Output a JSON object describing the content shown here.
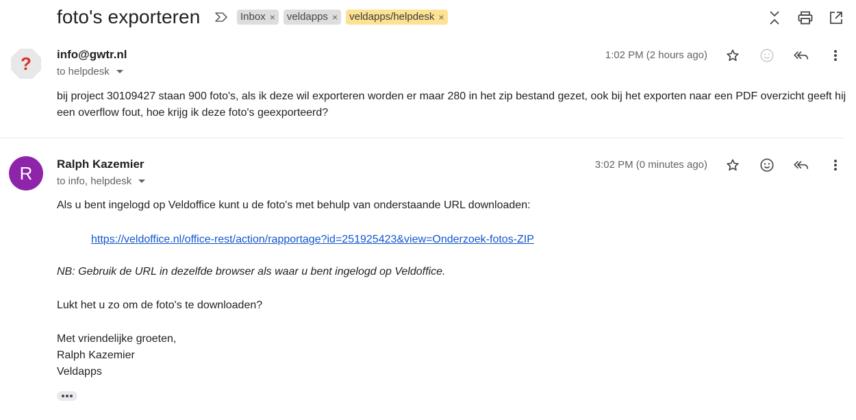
{
  "thread": {
    "subject": "foto's exporteren",
    "labels": [
      {
        "text": "Inbox",
        "color": "#dddddd"
      },
      {
        "text": "veldapps",
        "color": "#dddddd"
      },
      {
        "text": "veldapps/helpdesk",
        "color": "#fde293"
      }
    ],
    "remove_glyph": "×"
  },
  "messages": [
    {
      "avatar_letter": "?",
      "sender": "info@gwtr.nl",
      "to": "to helpdesk",
      "time": "1:02 PM (2 hours ago)",
      "body": [
        "bij project 30109427 staan 900 foto's, als ik deze wil exporteren worden er maar 280 in het zip bestand gezet, ook bij het exporten naar een PDF overzicht geeft hij een overflow fout, hoe krijg ik deze foto's geexporteerd?"
      ]
    },
    {
      "avatar_letter": "R",
      "avatar_color": "#8e24aa",
      "sender": "Ralph Kazemier",
      "to": "to info, helpdesk",
      "time": "3:02 PM (0 minutes ago)",
      "body_intro": "Als u bent ingelogd op Veldoffice kunt u de foto's met behulp van onderstaande URL downloaden:",
      "link": "https://veldoffice.nl/office-rest/action/rapportage?id=251925423&view=Onderzoek-fotos-ZIP",
      "note": "NB: Gebruik de URL in dezelfde browser als waar u bent ingelogd op Veldoffice.",
      "question": "Lukt het u zo om de foto's te downloaden?",
      "signature": [
        "Met vriendelijke groeten,",
        "Ralph Kazemier",
        "Veldapps"
      ]
    }
  ]
}
